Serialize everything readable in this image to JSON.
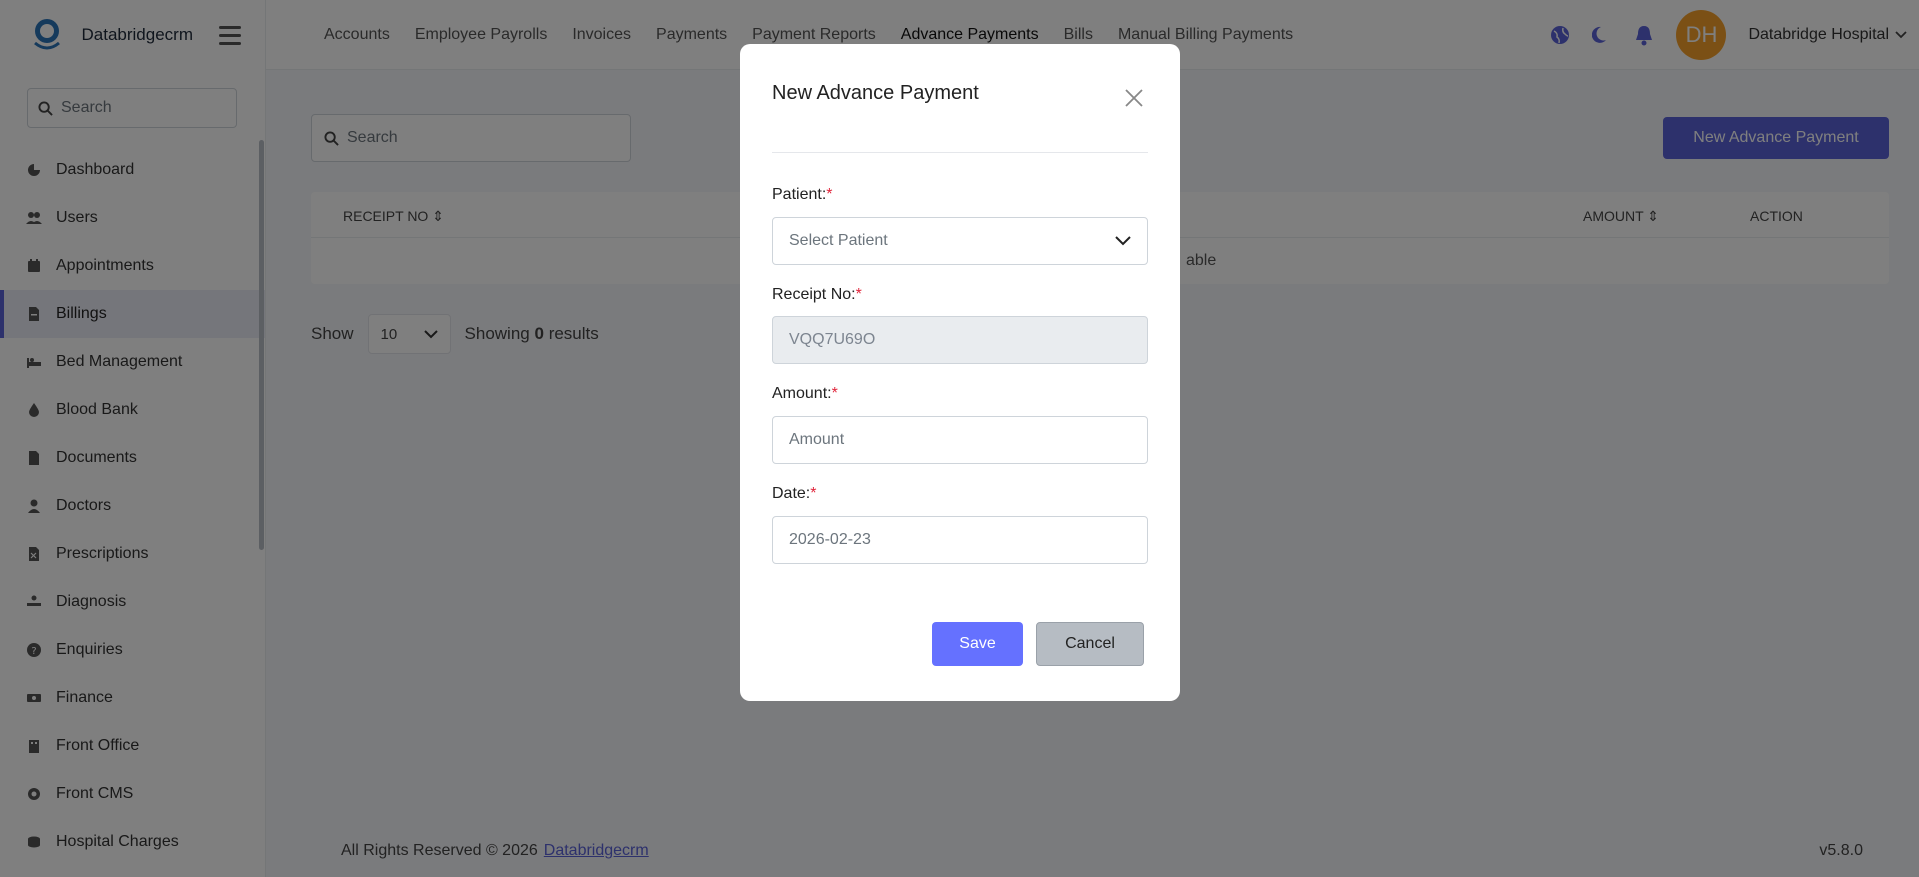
{
  "brand": {
    "name": "Databridgecrm"
  },
  "sidebar": {
    "search_placeholder": "Search",
    "items": [
      {
        "label": "Dashboard",
        "icon": "dashboard-icon"
      },
      {
        "label": "Users",
        "icon": "users-icon"
      },
      {
        "label": "Appointments",
        "icon": "calendar-icon"
      },
      {
        "label": "Billings",
        "icon": "file-invoice-icon",
        "active": true
      },
      {
        "label": "Bed Management",
        "icon": "bed-icon"
      },
      {
        "label": "Blood Bank",
        "icon": "blood-drop-icon"
      },
      {
        "label": "Documents",
        "icon": "document-icon"
      },
      {
        "label": "Doctors",
        "icon": "doctor-icon"
      },
      {
        "label": "Prescriptions",
        "icon": "prescription-icon"
      },
      {
        "label": "Diagnosis",
        "icon": "diagnosis-icon"
      },
      {
        "label": "Enquiries",
        "icon": "question-icon"
      },
      {
        "label": "Finance",
        "icon": "money-icon"
      },
      {
        "label": "Front Office",
        "icon": "building-icon"
      },
      {
        "label": "Front CMS",
        "icon": "gear-icon"
      },
      {
        "label": "Hospital Charges",
        "icon": "coins-icon"
      }
    ]
  },
  "topnav": {
    "links": [
      {
        "label": "Accounts"
      },
      {
        "label": "Employee Payrolls"
      },
      {
        "label": "Invoices"
      },
      {
        "label": "Payments"
      },
      {
        "label": "Payment Reports"
      },
      {
        "label": "Advance Payments",
        "active": true
      },
      {
        "label": "Bills"
      },
      {
        "label": "Manual Billing Payments"
      }
    ],
    "avatar_initials": "DH",
    "user_name": "Databridge Hospital"
  },
  "content": {
    "search_placeholder": "Search",
    "new_button": "New Advance Payment",
    "table": {
      "columns": [
        "RECEIPT NO",
        "AMOUNT",
        "ACTION"
      ],
      "empty_text_visible": "able"
    },
    "pager": {
      "show_label": "Show",
      "per_page": "10",
      "showing_prefix": "Showing",
      "showing_count": "0",
      "showing_suffix": "results"
    }
  },
  "footer": {
    "text": "All Rights Reserved © 2026",
    "link": "Databridgecrm",
    "version": "v5.8.0"
  },
  "modal": {
    "title": "New Advance Payment",
    "patient_label": "Patient:",
    "patient_placeholder": "Select Patient",
    "receipt_label": "Receipt No:",
    "receipt_value": "VQQ7U69O",
    "amount_label": "Amount:",
    "amount_placeholder": "Amount",
    "date_label": "Date:",
    "date_value": "2026-02-23",
    "required_mark": "*",
    "save_label": "Save",
    "cancel_label": "Cancel"
  },
  "colors": {
    "accent": "#5b63d9",
    "save": "#6571ff",
    "avatar": "#f6a12a",
    "required": "#e0243a"
  }
}
